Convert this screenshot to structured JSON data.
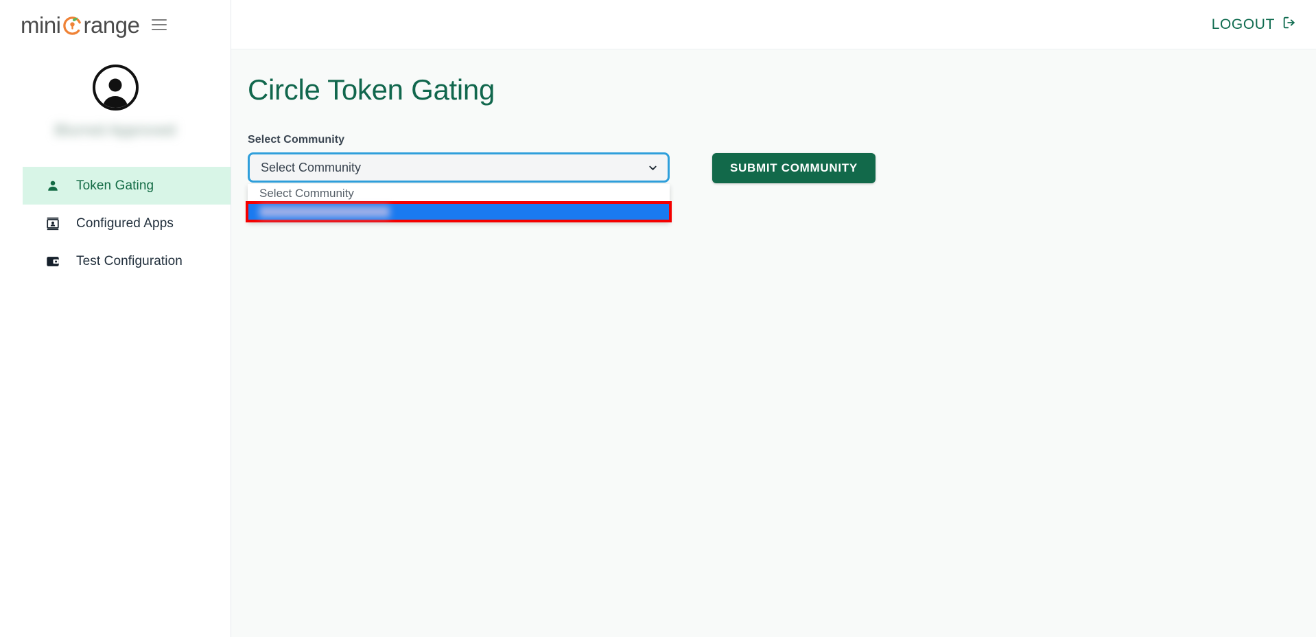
{
  "brand": {
    "logo_text_pre": "mini",
    "logo_text_post": "range",
    "menu_icon": "hamburger-menu-icon"
  },
  "sidebar": {
    "avatar_icon": "user-avatar-icon",
    "user_name": "Blurred Approved",
    "items": [
      {
        "label": "Token Gating",
        "icon": "person-icon",
        "active": true
      },
      {
        "label": "Configured Apps",
        "icon": "id-badge-icon",
        "active": false
      },
      {
        "label": "Test Configuration",
        "icon": "wallet-icon",
        "active": false
      }
    ]
  },
  "topbar": {
    "logout_label": "LOGOUT",
    "logout_icon": "logout-arrow-icon"
  },
  "main": {
    "page_title": "Circle Token Gating",
    "field": {
      "label": "Select Community",
      "selected_value": "Select Community",
      "chevron_icon": "chevron-down-icon",
      "options": [
        {
          "label": "Select Community",
          "selected": false,
          "redacted": false
        },
        {
          "label": "",
          "selected": true,
          "redacted": true
        }
      ]
    },
    "submit_label": "SUBMIT COMMUNITY"
  },
  "colors": {
    "accent_green": "#12694a",
    "heading_green": "#11674d",
    "active_nav_bg": "#d8f5e7",
    "focus_blue": "#2f9fdb",
    "option_blue": "#1a7af0",
    "highlight_red": "#f40000",
    "logo_orange": "#ef8236"
  }
}
